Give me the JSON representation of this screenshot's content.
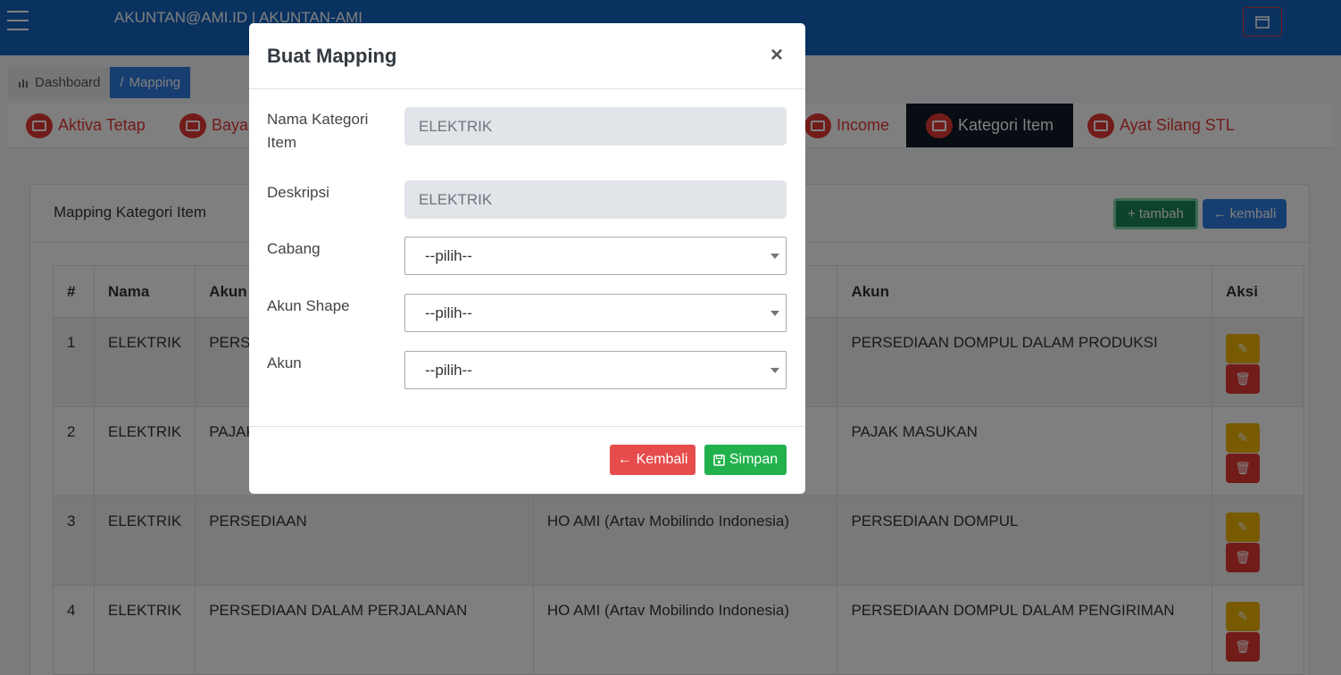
{
  "header": {
    "user": "AKUNTAN@AMI.ID | AKUNTAN-AMI"
  },
  "breadcrumb": [
    {
      "label": "Dashboard",
      "icon": "chart-icon"
    },
    {
      "label": "Mapping",
      "icon": "slash"
    }
  ],
  "tabs": [
    {
      "label": "Aktiva Tetap",
      "icon": "factory-icon"
    },
    {
      "label": "Bayar",
      "icon": "wallet-icon"
    },
    {
      "label": "Income",
      "icon": "money-icon"
    },
    {
      "label": "Kategori Item",
      "icon": "checkbox-icon",
      "active": true
    },
    {
      "label": "Ayat Silang STL",
      "icon": "wallet-icon"
    }
  ],
  "card": {
    "title": "Mapping Kategori Item",
    "btn_tambah": "tambah",
    "btn_kembali": "kembali"
  },
  "table": {
    "headers": [
      "#",
      "Nama",
      "Akun",
      "",
      "Akun",
      "Aksi"
    ],
    "rows": [
      {
        "no": "1",
        "nama": "ELEKTRIK",
        "akun1": "PERSE",
        "cabang": "",
        "akun2": "PERSEDIAAN DOMPUL DALAM PRODUKSI"
      },
      {
        "no": "2",
        "nama": "ELEKTRIK",
        "akun1": "PAJAK",
        "cabang": "",
        "akun2": "PAJAK MASUKAN"
      },
      {
        "no": "3",
        "nama": "ELEKTRIK",
        "akun1": "PERSEDIAAN",
        "cabang": "HO AMI (Artav Mobilindo Indonesia)",
        "akun2": "PERSEDIAAN DOMPUL"
      },
      {
        "no": "4",
        "nama": "ELEKTRIK",
        "akun1": "PERSEDIAAN DALAM PERJALANAN",
        "cabang": "HO AMI (Artav Mobilindo Indonesia)",
        "akun2": "PERSEDIAAN DOMPUL DALAM PENGIRIMAN"
      }
    ]
  },
  "modal": {
    "title": "Buat Mapping",
    "close": "×",
    "fields": {
      "nama_kategori": {
        "label": "Nama Kategori Item",
        "value": "ELEKTRIK"
      },
      "deskripsi": {
        "label": "Deskripsi",
        "value": "ELEKTRIK"
      },
      "cabang": {
        "label": "Cabang",
        "value": "--pilih--"
      },
      "akun_shape": {
        "label": "Akun Shape",
        "value": "--pilih--"
      },
      "akun": {
        "label": "Akun",
        "value": "--pilih--"
      }
    },
    "btn_kembali": "Kembali",
    "btn_simpan": "Simpan"
  },
  "colors": {
    "topbar": "#1565c0",
    "tab_text": "#e53935",
    "active_tab": "#111827",
    "btn_kembali": "#e74c4c",
    "btn_simpan": "#22b14c",
    "btn_tambah": "#198754",
    "btn_kembali_top": "#2f7de0"
  }
}
